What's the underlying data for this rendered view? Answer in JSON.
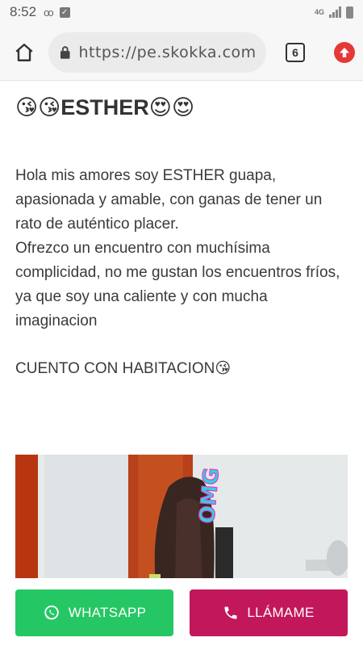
{
  "status_bar": {
    "time": "8:52",
    "network": "4G"
  },
  "browser": {
    "url": "https://pe.skokka.com/",
    "tab_count": "6"
  },
  "profile": {
    "title": "😘😘ESTHER😍😍",
    "description": [
      "Hola mis amores soy ESTHER guapa, apasionada y amable, con ganas de tener un rato de auténtico placer.",
      "Ofrezco un encuentro con muchísima complicidad, no me gustan los encuentros fríos, ya que soy una caliente y con mucha imaginacion"
    ],
    "room_note": "CUENTO CON HABITACION😘",
    "photo_watermark": "OMG"
  },
  "actions": {
    "whatsapp_label": "WHATSAPP",
    "call_label": "LLÁMAME"
  },
  "colors": {
    "whatsapp": "#25c764",
    "call": "#c2185b",
    "upload_badge": "#e53935"
  }
}
